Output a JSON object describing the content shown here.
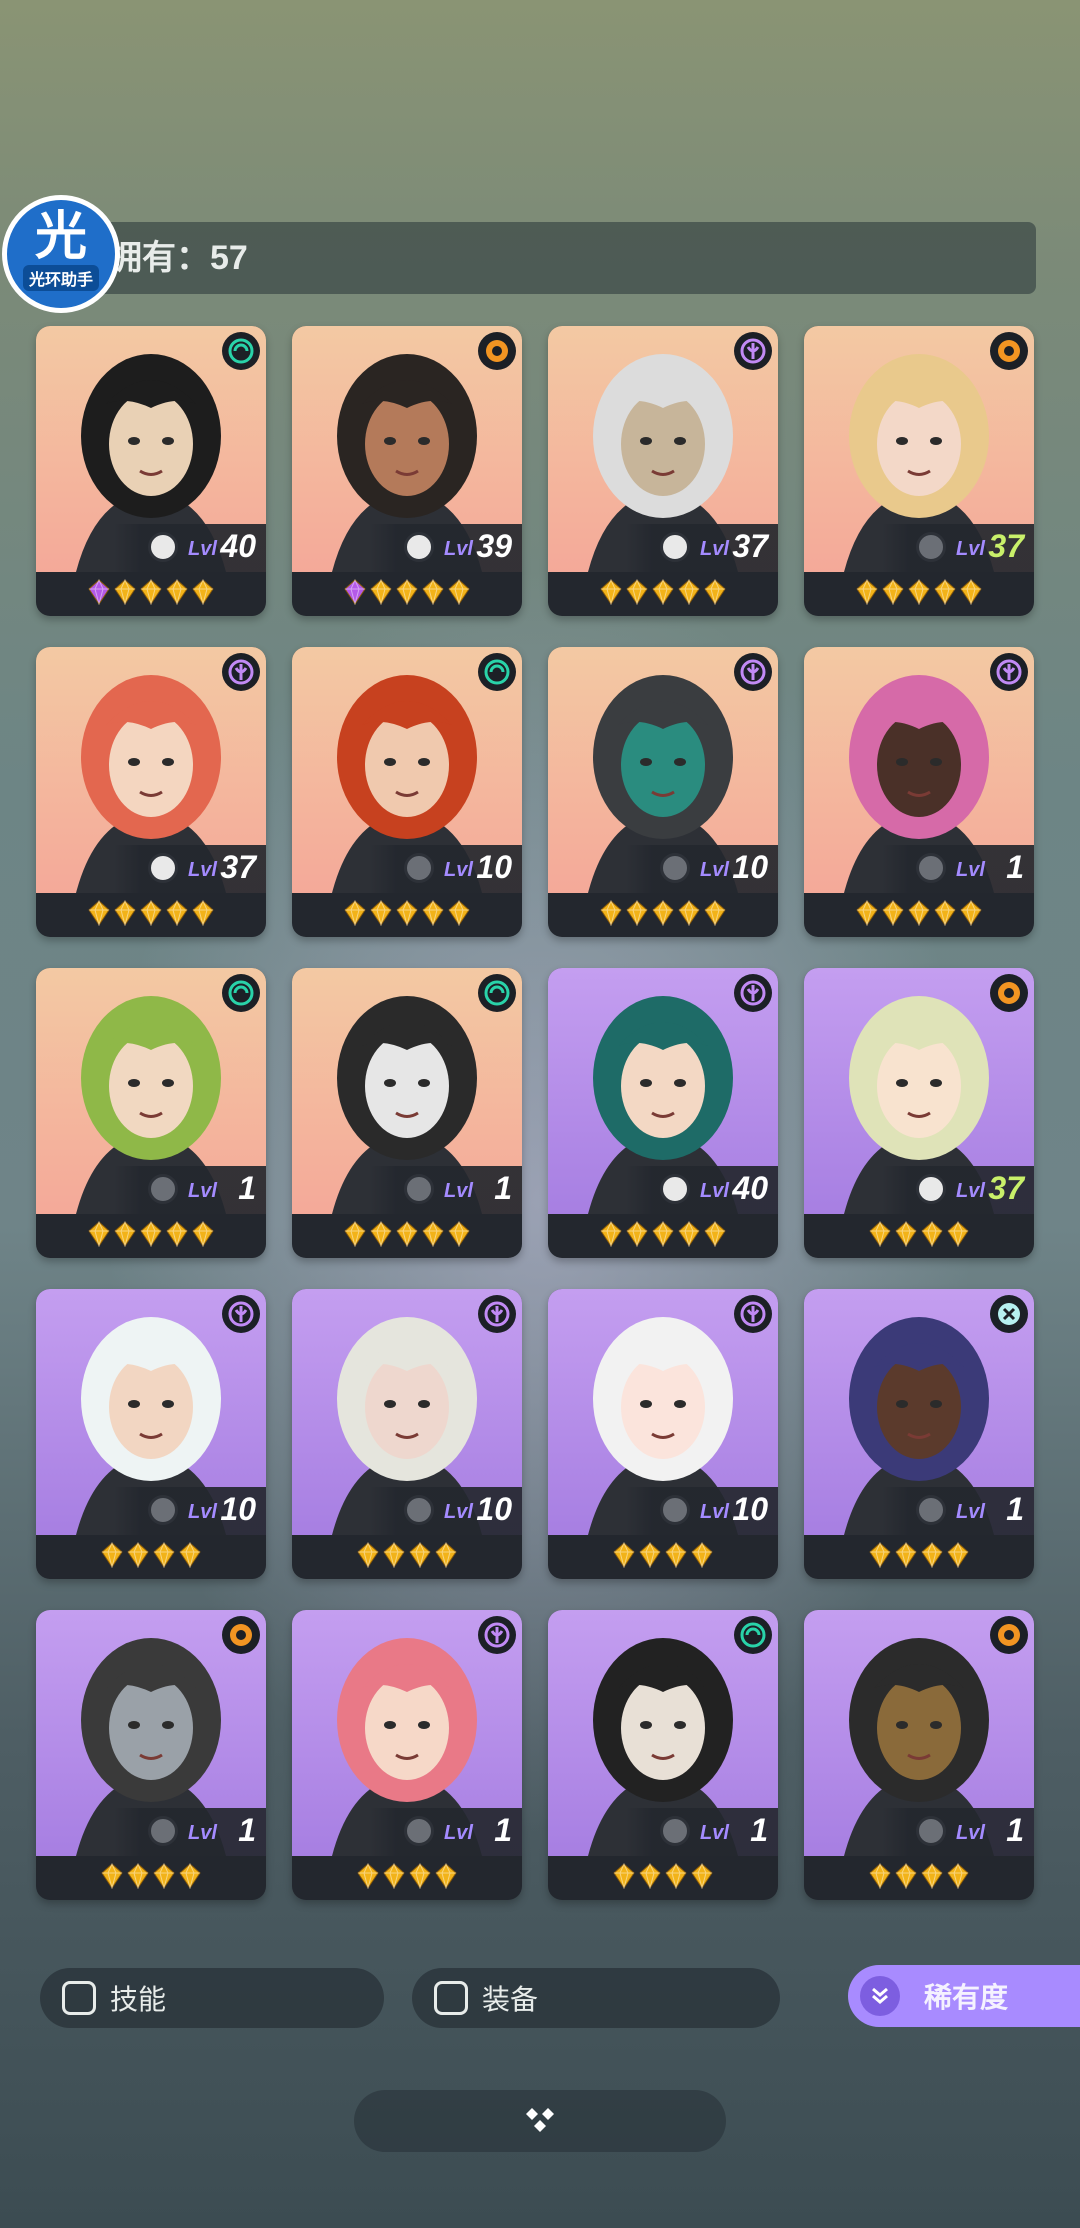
{
  "header": {
    "count_label": "拥有：57",
    "logo_char": "光",
    "logo_caption": "光环助手"
  },
  "colors": {
    "peach": [
      "#f3c9a3",
      "#f4a999"
    ],
    "purple": [
      "#c49ef0",
      "#a77fe2"
    ],
    "accent_purple": "#a88bff",
    "lvl_lime": "#c9f06a",
    "gem_gold": "#f2b319",
    "gem_purple": "#b55ae8"
  },
  "cards": [
    {
      "element": "wind-icon",
      "lvl_prefix": "Lvl",
      "lvl": "40",
      "lvl_color": "white",
      "aperture": "white",
      "bg": "peach",
      "gems": [
        "purple",
        "gold",
        "gold",
        "gold",
        "gold"
      ],
      "hair": "#1d1d1d",
      "skin": "#e9d1b5"
    },
    {
      "element": "fire-icon",
      "lvl_prefix": "Lvl",
      "lvl": "39",
      "lvl_color": "white",
      "aperture": "white",
      "bg": "peach",
      "gems": [
        "purple",
        "gold",
        "gold",
        "gold",
        "gold"
      ],
      "hair": "#2a2522",
      "skin": "#b47a5a"
    },
    {
      "element": "dark-icon",
      "lvl_prefix": "Lvl",
      "lvl": "37",
      "lvl_color": "white",
      "aperture": "white",
      "bg": "peach",
      "gems": [
        "gold",
        "gold",
        "gold",
        "gold",
        "gold"
      ],
      "hair": "#dcdcdc",
      "skin": "#c7b59a"
    },
    {
      "element": "fire-icon",
      "lvl_prefix": "Lvl",
      "lvl": "37",
      "lvl_color": "lime",
      "aperture": "gray",
      "bg": "peach",
      "gems": [
        "gold",
        "gold",
        "gold",
        "gold",
        "gold"
      ],
      "hair": "#e9c98c",
      "skin": "#f3d8c8"
    },
    {
      "element": "dark-icon",
      "lvl_prefix": "Lvl",
      "lvl": "37",
      "lvl_color": "white",
      "aperture": "white",
      "bg": "peach",
      "gems": [
        "gold",
        "gold",
        "gold",
        "gold",
        "gold"
      ],
      "hair": "#e3674f",
      "skin": "#f4d6c0"
    },
    {
      "element": "wind-icon",
      "lvl_prefix": "Lvl",
      "lvl": "10",
      "lvl_color": "white",
      "aperture": "gray",
      "bg": "peach",
      "gems": [
        "gold",
        "gold",
        "gold",
        "gold",
        "gold"
      ],
      "hair": "#c7411f",
      "skin": "#f0c9ae"
    },
    {
      "element": "dark-icon",
      "lvl_prefix": "Lvl",
      "lvl": "10",
      "lvl_color": "white",
      "aperture": "gray",
      "bg": "peach",
      "gems": [
        "gold",
        "gold",
        "gold",
        "gold",
        "gold"
      ],
      "hair": "#3a3d40",
      "skin": "#2a8c7f"
    },
    {
      "element": "dark-icon",
      "lvl_prefix": "Lvl",
      "lvl": "1",
      "lvl_color": "white",
      "aperture": "gray",
      "bg": "peach",
      "gems": [
        "gold",
        "gold",
        "gold",
        "gold",
        "gold"
      ],
      "hair": "#d66aa8",
      "skin": "#4a3028"
    },
    {
      "element": "wind-icon",
      "lvl_prefix": "Lvl",
      "lvl": "1",
      "lvl_color": "white",
      "aperture": "gray",
      "bg": "peach",
      "gems": [
        "gold",
        "gold",
        "gold",
        "gold",
        "gold"
      ],
      "hair": "#8fb848",
      "skin": "#f1d8c1"
    },
    {
      "element": "wind-icon",
      "lvl_prefix": "Lvl",
      "lvl": "1",
      "lvl_color": "white",
      "aperture": "gray",
      "bg": "peach",
      "gems": [
        "gold",
        "gold",
        "gold",
        "gold",
        "gold"
      ],
      "hair": "#2a2a2a",
      "skin": "#e6e6e6"
    },
    {
      "element": "dark-icon",
      "lvl_prefix": "Lvl",
      "lvl": "40",
      "lvl_color": "white",
      "aperture": "white",
      "bg": "purple",
      "gems": [
        "gold",
        "gold",
        "gold",
        "gold",
        "gold"
      ],
      "hair": "#1e6b67",
      "skin": "#f3d8c4"
    },
    {
      "element": "fire-icon",
      "lvl_prefix": "Lvl",
      "lvl": "37",
      "lvl_color": "lime",
      "aperture": "white",
      "bg": "purple",
      "gems": [
        "gold",
        "gold",
        "gold",
        "gold"
      ],
      "hair": "#dfe3b8",
      "skin": "#f8e3cf"
    },
    {
      "element": "dark-icon",
      "lvl_prefix": "Lvl",
      "lvl": "10",
      "lvl_color": "white",
      "aperture": "gray",
      "bg": "purple",
      "gems": [
        "gold",
        "gold",
        "gold",
        "gold"
      ],
      "hair": "#eef4f4",
      "skin": "#f2d6c2"
    },
    {
      "element": "dark-icon",
      "lvl_prefix": "Lvl",
      "lvl": "10",
      "lvl_color": "white",
      "aperture": "gray",
      "bg": "purple",
      "gems": [
        "gold",
        "gold",
        "gold",
        "gold"
      ],
      "hair": "#e5e5dd",
      "skin": "#eed7ce"
    },
    {
      "element": "dark-icon",
      "lvl_prefix": "Lvl",
      "lvl": "10",
      "lvl_color": "white",
      "aperture": "gray",
      "bg": "purple",
      "gems": [
        "gold",
        "gold",
        "gold",
        "gold"
      ],
      "hair": "#f2f2f2",
      "skin": "#fbe4dc"
    },
    {
      "element": "cross-icon",
      "lvl_prefix": "Lvl",
      "lvl": "1",
      "lvl_color": "white",
      "aperture": "gray",
      "bg": "purple",
      "gems": [
        "gold",
        "gold",
        "gold",
        "gold"
      ],
      "hair": "#3b3a78",
      "skin": "#5b3a2c"
    },
    {
      "element": "fire-icon",
      "lvl_prefix": "Lvl",
      "lvl": "1",
      "lvl_color": "white",
      "aperture": "gray",
      "bg": "purple",
      "gems": [
        "gold",
        "gold",
        "gold",
        "gold"
      ],
      "hair": "#3a3a3a",
      "skin": "#9aa1a8"
    },
    {
      "element": "dark-icon",
      "lvl_prefix": "Lvl",
      "lvl": "1",
      "lvl_color": "white",
      "aperture": "gray",
      "bg": "purple",
      "gems": [
        "gold",
        "gold",
        "gold",
        "gold"
      ],
      "hair": "#e97987",
      "skin": "#f6d8c8"
    },
    {
      "element": "wind-icon",
      "lvl_prefix": "Lvl",
      "lvl": "1",
      "lvl_color": "white",
      "aperture": "gray",
      "bg": "purple",
      "gems": [
        "gold",
        "gold",
        "gold",
        "gold"
      ],
      "hair": "#222222",
      "skin": "#e8e0d6"
    },
    {
      "element": "fire-icon",
      "lvl_prefix": "Lvl",
      "lvl": "1",
      "lvl_color": "white",
      "aperture": "gray",
      "bg": "purple",
      "gems": [
        "gold",
        "gold",
        "gold",
        "gold"
      ],
      "hair": "#2b2b2b",
      "skin": "#8a6a3a"
    }
  ],
  "filters": {
    "skill_label": "技能",
    "equipment_label": "装备",
    "rarity_label": "稀有度"
  }
}
